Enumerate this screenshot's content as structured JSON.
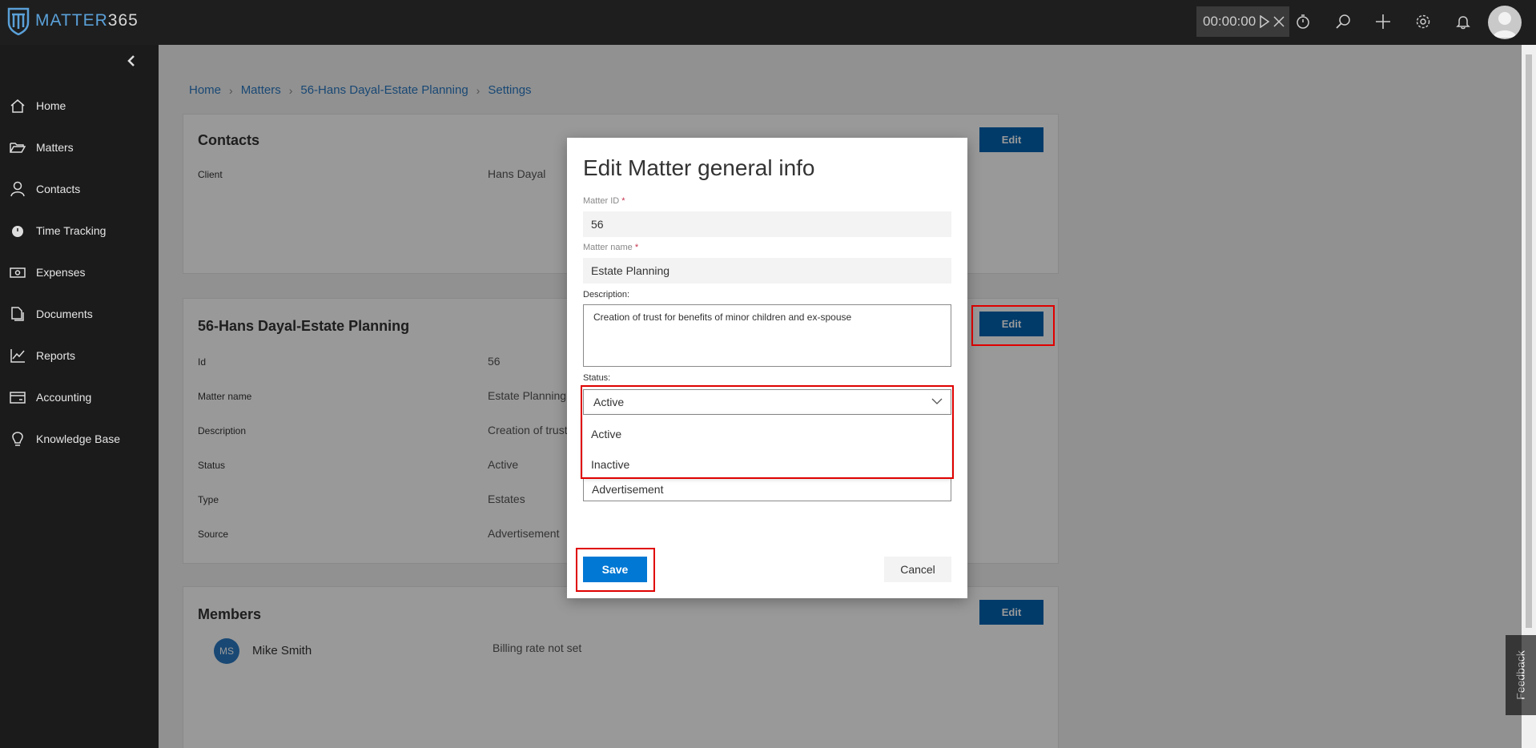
{
  "app": {
    "logo_text_a": "MATTER",
    "logo_text_b": "365"
  },
  "topbar": {
    "timer": "00:00:00",
    "icons": [
      "play-icon",
      "close-icon",
      "stopwatch-icon",
      "search-icon",
      "plus-icon",
      "gear-icon",
      "bell-icon",
      "user-avatar"
    ]
  },
  "sidebar": {
    "items": [
      {
        "label": "Home",
        "icon": "home-icon"
      },
      {
        "label": "Matters",
        "icon": "folder-icon"
      },
      {
        "label": "Contacts",
        "icon": "person-icon"
      },
      {
        "label": "Time Tracking",
        "icon": "stopwatch-icon"
      },
      {
        "label": "Expenses",
        "icon": "money-icon"
      },
      {
        "label": "Documents",
        "icon": "documents-icon"
      },
      {
        "label": "Reports",
        "icon": "chart-icon"
      },
      {
        "label": "Accounting",
        "icon": "card-icon"
      },
      {
        "label": "Knowledge Base",
        "icon": "lightbulb-icon"
      }
    ]
  },
  "breadcrumb": [
    "Home",
    "Matters",
    "56-Hans Dayal-Estate Planning",
    "Settings"
  ],
  "contacts_card": {
    "title": "Contacts",
    "edit": "Edit",
    "client_label": "Client",
    "client_value": "Hans Dayal"
  },
  "matter_card": {
    "title": "56-Hans Dayal-Estate Planning",
    "edit": "Edit",
    "rows": [
      {
        "label": "Id",
        "value": "56"
      },
      {
        "label": "Matter name",
        "value": "Estate Planning"
      },
      {
        "label": "Description",
        "value": "Creation of trust"
      },
      {
        "label": "Status",
        "value": "Active"
      },
      {
        "label": "Type",
        "value": "Estates"
      },
      {
        "label": "Source",
        "value": "Advertisement"
      }
    ]
  },
  "members_card": {
    "title": "Members",
    "edit": "Edit",
    "member_initials": "MS",
    "member_name": "Mike Smith",
    "billing": "Billing rate not set"
  },
  "feedback": "Feedback",
  "modal": {
    "title": "Edit Matter general info",
    "matter_id_label": "Matter ID",
    "matter_id_value": "56",
    "matter_name_label": "Matter name",
    "matter_name_value": "Estate Planning",
    "required_mark": "*",
    "description_label": "Description:",
    "description_value": "Creation of trust for benefits of minor children and ex-spouse",
    "status_label": "Status:",
    "status_value": "Active",
    "status_options": [
      "Active",
      "Inactive"
    ],
    "source_value": "Advertisement",
    "save": "Save",
    "cancel": "Cancel"
  },
  "colors": {
    "accent": "#0078d4",
    "edit_button": "#0063b1",
    "highlight": "#e00000",
    "link": "#2b79c2"
  }
}
